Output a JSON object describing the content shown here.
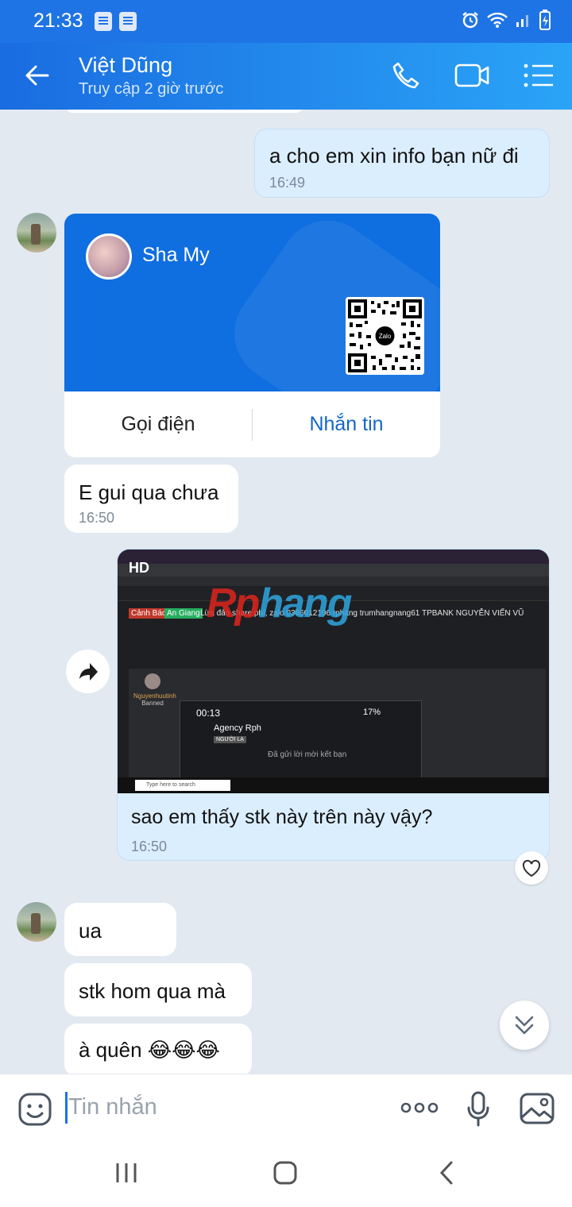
{
  "status_bar": {
    "time": "21:33",
    "battery": "battery-charging-icon"
  },
  "header": {
    "contact_name": "Việt Dũng",
    "last_seen": "Truy cập 2 giờ trước",
    "icons": [
      "back-arrow-icon",
      "phone-icon",
      "video-call-icon",
      "menu-list-icon"
    ]
  },
  "messages": [
    {
      "from": "me",
      "text": "a cho em xin info bạn nữ đi",
      "time": "16:49"
    },
    {
      "from": "contact",
      "type": "contact_card",
      "card": {
        "name": "Sha My",
        "qr_label": "Zalo",
        "call_label": "Gọi điện",
        "message_label": "Nhắn tin"
      }
    },
    {
      "from": "contact",
      "text": "E gui qua chưa",
      "time": "16:50"
    },
    {
      "from": "me",
      "type": "image",
      "caption": "sao em thấy stk này trên này vậy?",
      "time": "16:50",
      "screenshot": {
        "quality_badge": "HD",
        "tag_warning": "Cảnh Báo",
        "tag_location": "An Giang",
        "thread_title": "Lừa đảo share phí, zalo 0386012106 rphang trumhangnang61 TPBANK NGUYỄN VIẾN VŨ",
        "watermark_red": "Rp",
        "watermark_blue": "hang",
        "poster_name": "Nguyenhuutinh",
        "poster_status": "Banned",
        "phone_time": "00:13",
        "phone_battery": "17%",
        "phone_contact": "Agency Rph",
        "phone_tag": "NGƯỜI LẠ",
        "friend_request_text": "Đã gửi lời mời kết bạn",
        "taskbar_search": "Type here to search"
      }
    },
    {
      "from": "contact",
      "text": "ua"
    },
    {
      "from": "contact",
      "text": "stk hom qua mà"
    },
    {
      "from": "contact",
      "text": "à quên 😂😂😂"
    }
  ],
  "input": {
    "placeholder": "Tin nhắn"
  },
  "colors": {
    "header": "#1f74e5",
    "outgoing_bubble": "#dbeefe",
    "incoming_bubble": "#ffffff",
    "card_blue": "#0f6ee0",
    "link_blue": "#1466c8"
  }
}
